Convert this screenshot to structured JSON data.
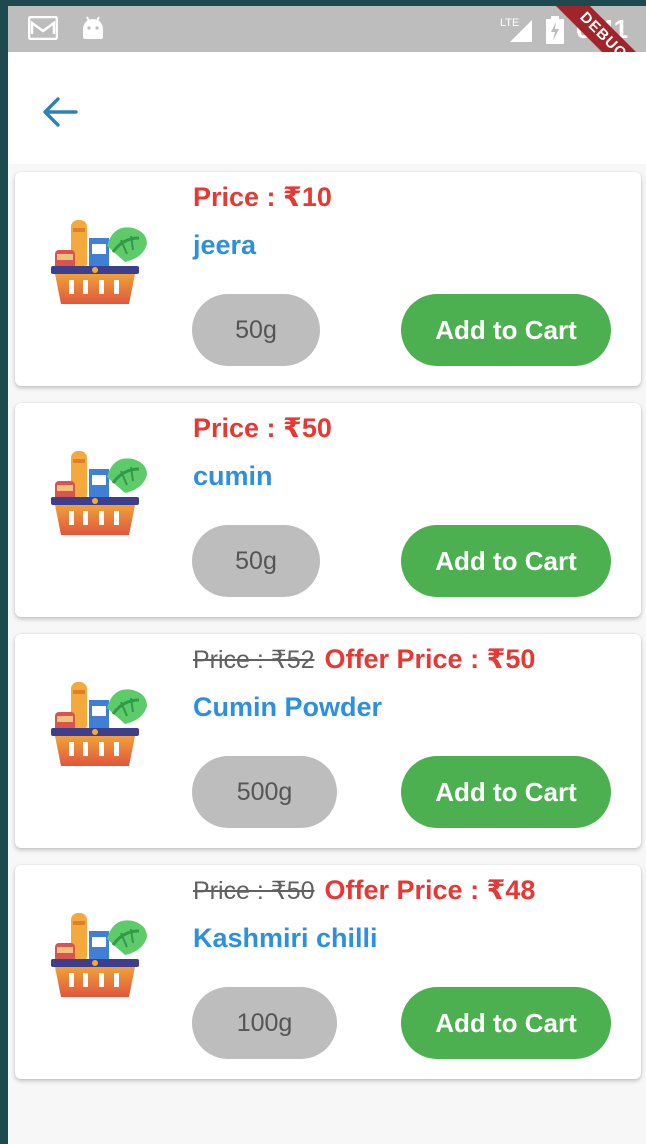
{
  "status_bar": {
    "time": "6:41",
    "network": "LTE",
    "debug_banner": "DEBUG"
  },
  "app_bar": {
    "back_icon": "arrow-back-icon"
  },
  "colors": {
    "price_red": "#e53935",
    "name_blue": "#2c8fe0",
    "cart_green": "#4caf50",
    "pill_grey": "#bdbdbd"
  },
  "products": [
    {
      "old_price": "",
      "price": "Price : ₹10",
      "name": "jeera",
      "weight": "50g",
      "cart_label": "Add to Cart"
    },
    {
      "old_price": "",
      "price": "Price : ₹50",
      "name": "cumin",
      "weight": "50g",
      "cart_label": "Add to Cart"
    },
    {
      "old_price": "Price : ₹52",
      "price": "Offer Price : ₹50",
      "name": "Cumin Powder",
      "weight": "500g",
      "cart_label": "Add to Cart"
    },
    {
      "old_price": "Price : ₹50",
      "price": "Offer Price : ₹48",
      "name": "Kashmiri chilli",
      "weight": "100g",
      "cart_label": "Add to Cart"
    }
  ]
}
